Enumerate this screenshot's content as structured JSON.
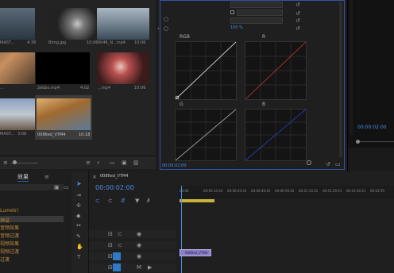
{
  "project": {
    "items": [
      {
        "label": "MAST...",
        "duration": "4:38"
      },
      {
        "label": "Bimg.jpg",
        "duration": "10:06"
      },
      {
        "label": "0046_N...mp4",
        "duration": "10:06"
      },
      {
        "label": "...",
        "duration": ""
      },
      {
        "label": "2ebbs.mp4",
        "duration": "4:02"
      },
      {
        "label": "...mp4",
        "duration": "10:06"
      },
      {
        "label": "MAST...",
        "duration": "3:08"
      },
      {
        "label": "0086ed_VTM4",
        "duration": "10:18"
      }
    ]
  },
  "effect": {
    "master_label": "RGB",
    "channel_label": "R",
    "green_label": "G",
    "blue_label": "B",
    "timecode": "00:00:02:00",
    "tick_percent": "100 %"
  },
  "program": {
    "timecode": "00:00:02:00"
  },
  "lpanel": {
    "tab": "效果",
    "items": [
      "Lumetri",
      "预设",
      "音频效果",
      "音频过渡",
      "视频效果",
      "视频过渡",
      "过渡"
    ]
  },
  "timeline": {
    "tab": "0086ed_VTM4",
    "timecode": "00:00:02:00",
    "ruler": [
      "00:00",
      "00:00:14:23",
      "00:00:29:23",
      "00:00:44:22",
      "00:00:59:22",
      "00:01:14:22",
      "00:01:29:21",
      "00:01:44:21",
      "00:01:59"
    ],
    "clip_label": "0086ed_VTM4"
  },
  "colors": {
    "accent": "#2f55a8",
    "clip_video": "#8a7fc8",
    "clip_yellow": "#c8b43a",
    "timecode_blue": "#4d8ce8"
  }
}
